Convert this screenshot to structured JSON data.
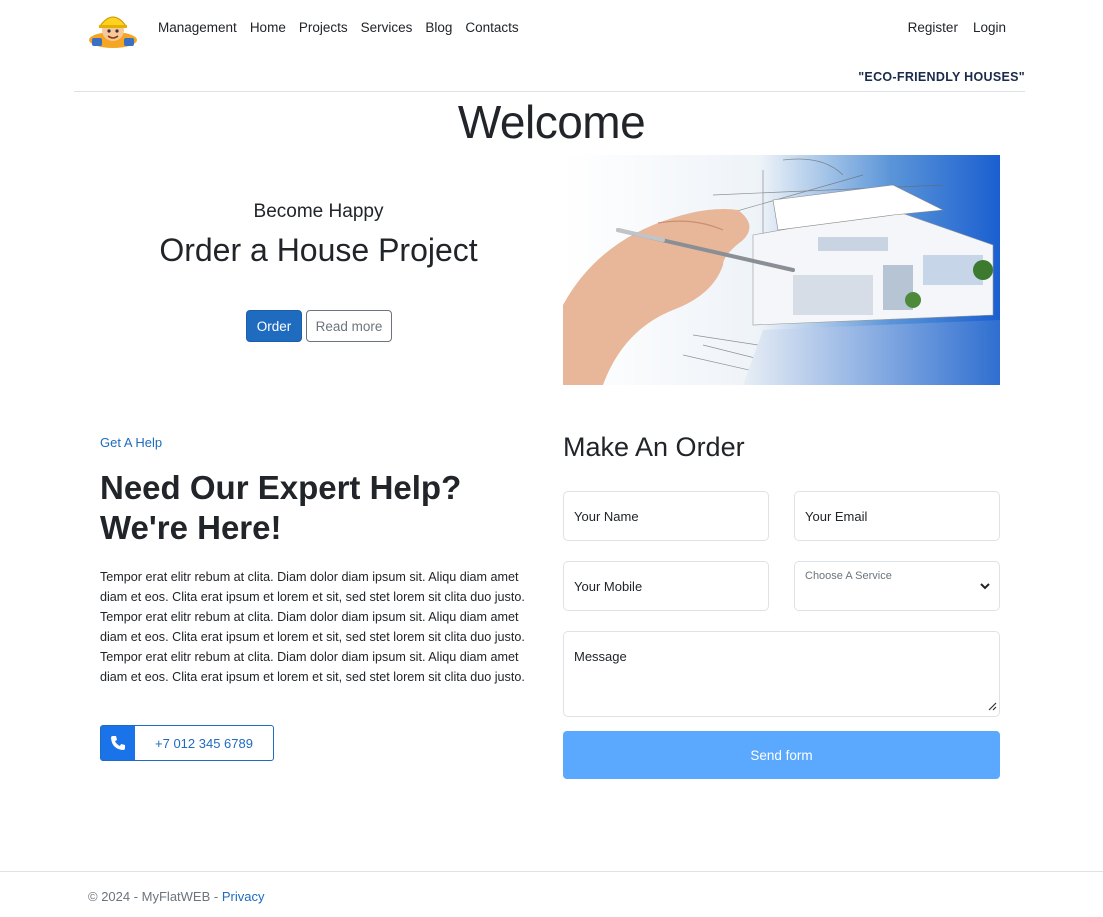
{
  "nav": {
    "links": [
      "Management",
      "Home",
      "Projects",
      "Services",
      "Blog",
      "Contacts"
    ],
    "register": "Register",
    "login": "Login",
    "tagline": "\"ECO-FRIENDLY HOUSES\""
  },
  "hero": {
    "welcome": "Welcome",
    "subtitle": "Become Happy",
    "title": "Order a House Project",
    "order_btn": "Order",
    "more_btn": "Read more"
  },
  "help": {
    "kicker": "Get A Help",
    "title": "Need Our Expert Help? We're Here!",
    "text": "Tempor erat elitr rebum at clita. Diam dolor diam ipsum sit. Aliqu diam amet diam et eos. Clita erat ipsum et lorem et sit, sed stet lorem sit clita duo justo. Tempor erat elitr rebum at clita. Diam dolor diam ipsum sit. Aliqu diam amet diam et eos. Clita erat ipsum et lorem et sit, sed stet lorem sit clita duo justo. Tempor erat elitr rebum at clita. Diam dolor diam ipsum sit. Aliqu diam amet diam et eos. Clita erat ipsum et lorem et sit, sed stet lorem sit clita duo justo.",
    "phone": "+7 012 345 6789"
  },
  "form": {
    "title": "Make An Order",
    "name_placeholder": "Your Name",
    "email_placeholder": "Your Email",
    "mobile_placeholder": "Your Mobile",
    "service_placeholder": "Choose A Service",
    "message_placeholder": "Message",
    "send": "Send form"
  },
  "footer": {
    "copyright": "© 2024 - MyFlatWEB - ",
    "privacy": "Privacy"
  },
  "colors": {
    "primary": "#1f6bbf",
    "send_button": "#5aa9ff",
    "phone_icon_bg": "#1a73e8"
  }
}
